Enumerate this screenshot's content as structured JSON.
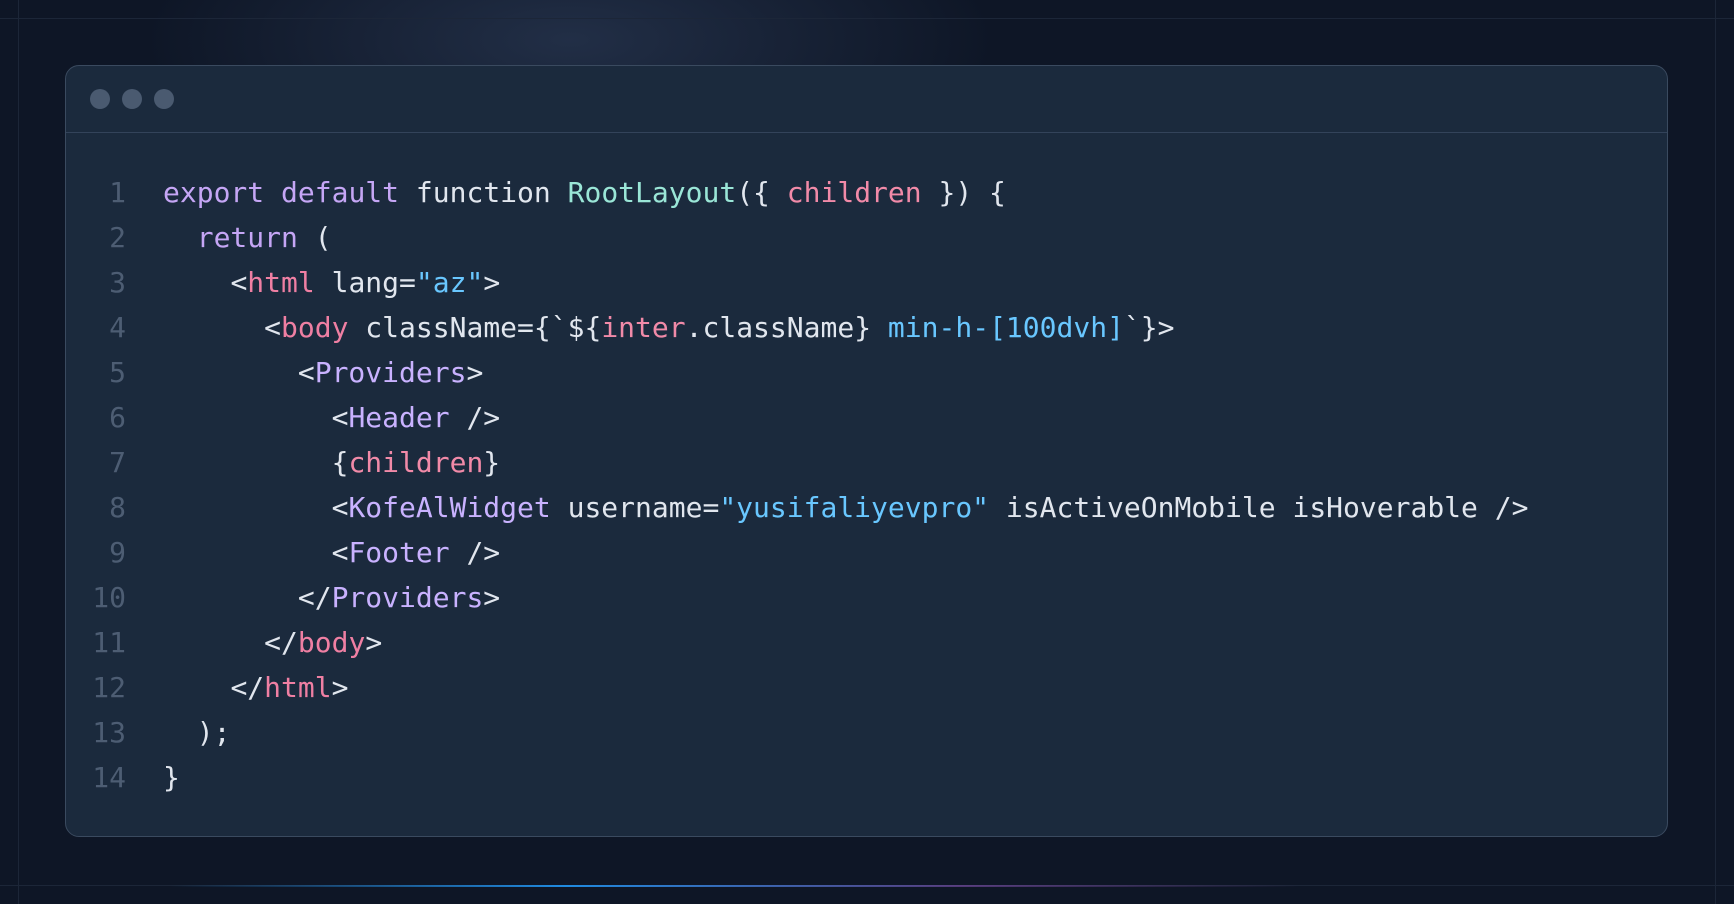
{
  "window": {
    "controls": [
      "dot",
      "dot",
      "dot"
    ]
  },
  "colors": {
    "keyword": "#c5a6f5",
    "function_name": "#9ae6d7",
    "param": "#f18aa8",
    "tag": "#ef7fa3",
    "component": "#c9b2ff",
    "string": "#69c7ff",
    "plain": "#e1e6ee",
    "line_number": "#4d5d73"
  },
  "code": {
    "lines": [
      {
        "n": "1",
        "indent": 0,
        "tokens": [
          {
            "t": "export",
            "c": "keyword"
          },
          {
            "t": " ",
            "c": "plain"
          },
          {
            "t": "default",
            "c": "keyword"
          },
          {
            "t": " function ",
            "c": "plain"
          },
          {
            "t": "RootLayout",
            "c": "function_name"
          },
          {
            "t": "({ ",
            "c": "plain"
          },
          {
            "t": "children",
            "c": "param"
          },
          {
            "t": " }) {",
            "c": "plain"
          }
        ]
      },
      {
        "n": "2",
        "indent": 2,
        "tokens": [
          {
            "t": "return",
            "c": "keyword"
          },
          {
            "t": " (",
            "c": "plain"
          }
        ]
      },
      {
        "n": "3",
        "indent": 4,
        "tokens": [
          {
            "t": "<",
            "c": "plain"
          },
          {
            "t": "html",
            "c": "tag"
          },
          {
            "t": " lang=",
            "c": "plain"
          },
          {
            "t": "\"az\"",
            "c": "string"
          },
          {
            "t": ">",
            "c": "plain"
          }
        ]
      },
      {
        "n": "4",
        "indent": 6,
        "tokens": [
          {
            "t": "<",
            "c": "plain"
          },
          {
            "t": "body",
            "c": "tag"
          },
          {
            "t": " className={`${",
            "c": "plain"
          },
          {
            "t": "inter",
            "c": "param"
          },
          {
            "t": ".className} ",
            "c": "plain"
          },
          {
            "t": "min-h-[100dvh]",
            "c": "string"
          },
          {
            "t": "`}>",
            "c": "plain"
          }
        ]
      },
      {
        "n": "5",
        "indent": 8,
        "tokens": [
          {
            "t": "<",
            "c": "plain"
          },
          {
            "t": "Providers",
            "c": "component"
          },
          {
            "t": ">",
            "c": "plain"
          }
        ]
      },
      {
        "n": "6",
        "indent": 10,
        "tokens": [
          {
            "t": "<",
            "c": "plain"
          },
          {
            "t": "Header",
            "c": "component"
          },
          {
            "t": " />",
            "c": "plain"
          }
        ]
      },
      {
        "n": "7",
        "indent": 10,
        "tokens": [
          {
            "t": "{",
            "c": "plain"
          },
          {
            "t": "children",
            "c": "param"
          },
          {
            "t": "}",
            "c": "plain"
          }
        ]
      },
      {
        "n": "8",
        "indent": 10,
        "tokens": [
          {
            "t": "<",
            "c": "plain"
          },
          {
            "t": "KofeAlWidget",
            "c": "component"
          },
          {
            "t": " username=",
            "c": "plain"
          },
          {
            "t": "\"yusifaliyevpro\"",
            "c": "string"
          },
          {
            "t": " isActiveOnMobile isHoverable />",
            "c": "plain"
          }
        ]
      },
      {
        "n": "9",
        "indent": 10,
        "tokens": [
          {
            "t": "<",
            "c": "plain"
          },
          {
            "t": "Footer",
            "c": "component"
          },
          {
            "t": " />",
            "c": "plain"
          }
        ]
      },
      {
        "n": "10",
        "indent": 8,
        "tokens": [
          {
            "t": "</",
            "c": "plain"
          },
          {
            "t": "Providers",
            "c": "component"
          },
          {
            "t": ">",
            "c": "plain"
          }
        ]
      },
      {
        "n": "11",
        "indent": 6,
        "tokens": [
          {
            "t": "</",
            "c": "plain"
          },
          {
            "t": "body",
            "c": "tag"
          },
          {
            "t": ">",
            "c": "plain"
          }
        ]
      },
      {
        "n": "12",
        "indent": 4,
        "tokens": [
          {
            "t": "</",
            "c": "plain"
          },
          {
            "t": "html",
            "c": "tag"
          },
          {
            "t": ">",
            "c": "plain"
          }
        ]
      },
      {
        "n": "13",
        "indent": 2,
        "tokens": [
          {
            "t": ");",
            "c": "plain"
          }
        ]
      },
      {
        "n": "14",
        "indent": 0,
        "tokens": [
          {
            "t": "}",
            "c": "plain"
          }
        ]
      }
    ]
  }
}
